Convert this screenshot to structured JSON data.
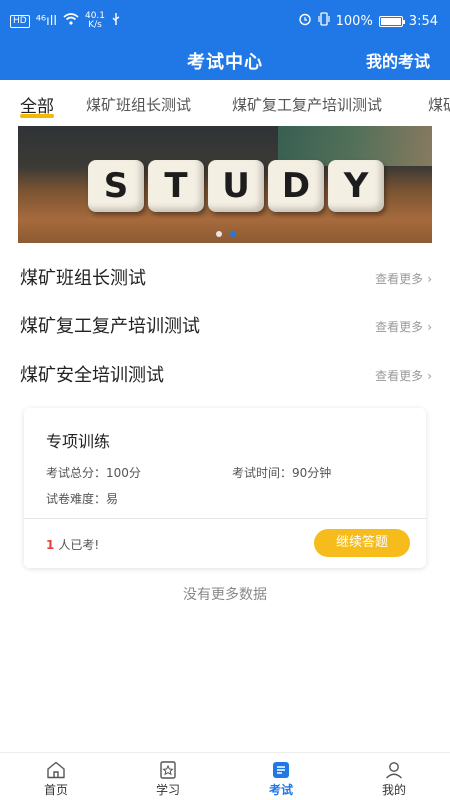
{
  "status_bar": {
    "hd": "HD",
    "signal": "⁴⁶ıll",
    "speed": "40.1",
    "speed_unit": "K/s",
    "battery_percent": "100%",
    "time": "3:54"
  },
  "header": {
    "title": "考试中心",
    "action": "我的考试"
  },
  "tabs": [
    {
      "label": "全部",
      "active": true
    },
    {
      "label": "煤矿班组长测试"
    },
    {
      "label": "煤矿复工复产培训测试"
    },
    {
      "label": "煤矿"
    }
  ],
  "banner": {
    "letters": [
      "S",
      "T",
      "U",
      "D",
      "Y"
    ],
    "slides": 2,
    "active_slide": 2
  },
  "sections": [
    {
      "title": "煤矿班组长测试",
      "more": "查看更多"
    },
    {
      "title": "煤矿复工复产培训测试",
      "more": "查看更多"
    },
    {
      "title": "煤矿安全培训测试",
      "more": "查看更多"
    }
  ],
  "card": {
    "title": "专项训练",
    "total_score": "考试总分：100分",
    "duration": "考试时间：90分钟",
    "difficulty": "试卷难度：易",
    "count_number": "1",
    "count_text": "人已考!",
    "button": "继续答题"
  },
  "footer_note": "没有更多数据",
  "bottom_nav": [
    {
      "label": "首页",
      "icon": "home-icon"
    },
    {
      "label": "学习",
      "icon": "study-icon"
    },
    {
      "label": "考试",
      "icon": "exam-icon",
      "active": true
    },
    {
      "label": "我的",
      "icon": "user-icon"
    }
  ],
  "colors": {
    "primary": "#1f78e5",
    "accent": "#f6bc1b",
    "underline": "#f5b800",
    "count": "#e8413c"
  }
}
